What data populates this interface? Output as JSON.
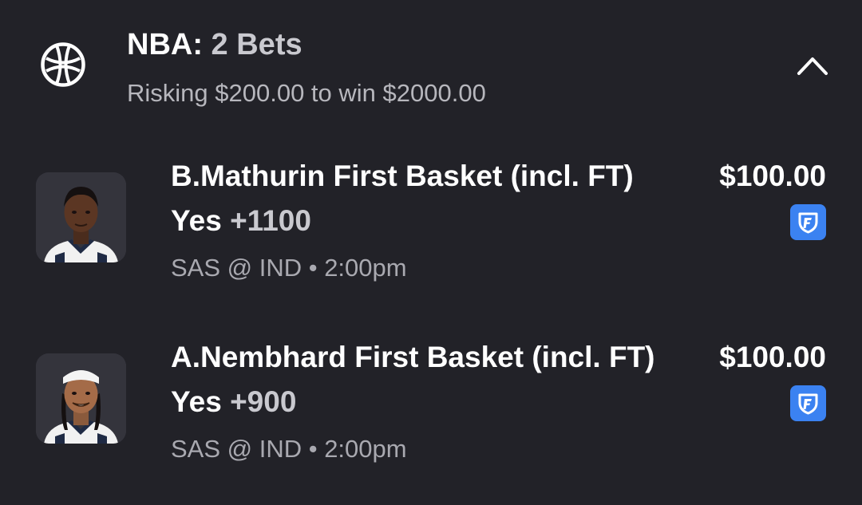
{
  "header": {
    "league": "NBA:",
    "bet_count": "2 Bets",
    "subtitle": "Risking $200.00 to win $2000.00",
    "sport_icon": "basketball-icon",
    "collapse_icon": "chevron-up-icon"
  },
  "bets": [
    {
      "title": "B.Mathurin First Basket (incl. FT)",
      "amount": "$100.00",
      "selection": "Yes",
      "odds": "+1100",
      "game": "SAS @ IND • 2:00pm",
      "book_icon": "fanduel-shield-icon"
    },
    {
      "title": "A.Nembhard First Basket (incl. FT)",
      "amount": "$100.00",
      "selection": "Yes",
      "odds": "+900",
      "game": "SAS @ IND • 2:00pm",
      "book_icon": "fanduel-shield-icon"
    }
  ],
  "colors": {
    "background": "#222228",
    "book_badge": "#3b82f1",
    "muted_text": "#a9a9b0"
  }
}
